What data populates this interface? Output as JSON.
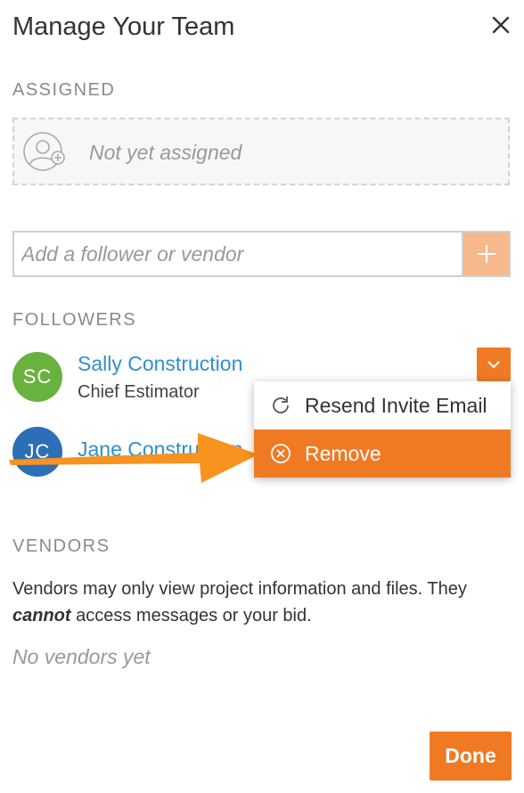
{
  "dialog": {
    "title": "Manage Your Team",
    "close_icon": "close-icon"
  },
  "assigned": {
    "label": "ASSIGNED",
    "empty_text": "Not yet assigned",
    "icon": "add-user-icon"
  },
  "add_follower": {
    "placeholder": "Add a follower or vendor",
    "value": "",
    "button_icon": "plus-icon"
  },
  "followers": {
    "label": "FOLLOWERS",
    "items": [
      {
        "initials": "SC",
        "name": "Sally Construction",
        "role": "Chief Estimator",
        "avatar_color": "#6ab23f"
      },
      {
        "initials": "JC",
        "name": "Jane Construction",
        "role": "",
        "avatar_color": "#2d6fb7"
      }
    ],
    "dropdown_icon": "chevron-down-icon"
  },
  "menu": {
    "items": [
      {
        "label": "Resend Invite Email",
        "icon": "refresh-icon"
      },
      {
        "label": "Remove",
        "icon": "remove-circle-icon",
        "highlighted": true
      }
    ]
  },
  "vendors": {
    "label": "VENDORS",
    "desc_part1": "Vendors may only view project information and files. They ",
    "desc_emph": "cannot",
    "desc_part2": " access messages or your bid.",
    "empty_text": "No vendors yet"
  },
  "actions": {
    "done_label": "Done"
  },
  "colors": {
    "accent": "#f07a24",
    "accent_light": "#f6b98b",
    "link": "#2f8fce",
    "annotation_arrow": "#f7931e"
  }
}
